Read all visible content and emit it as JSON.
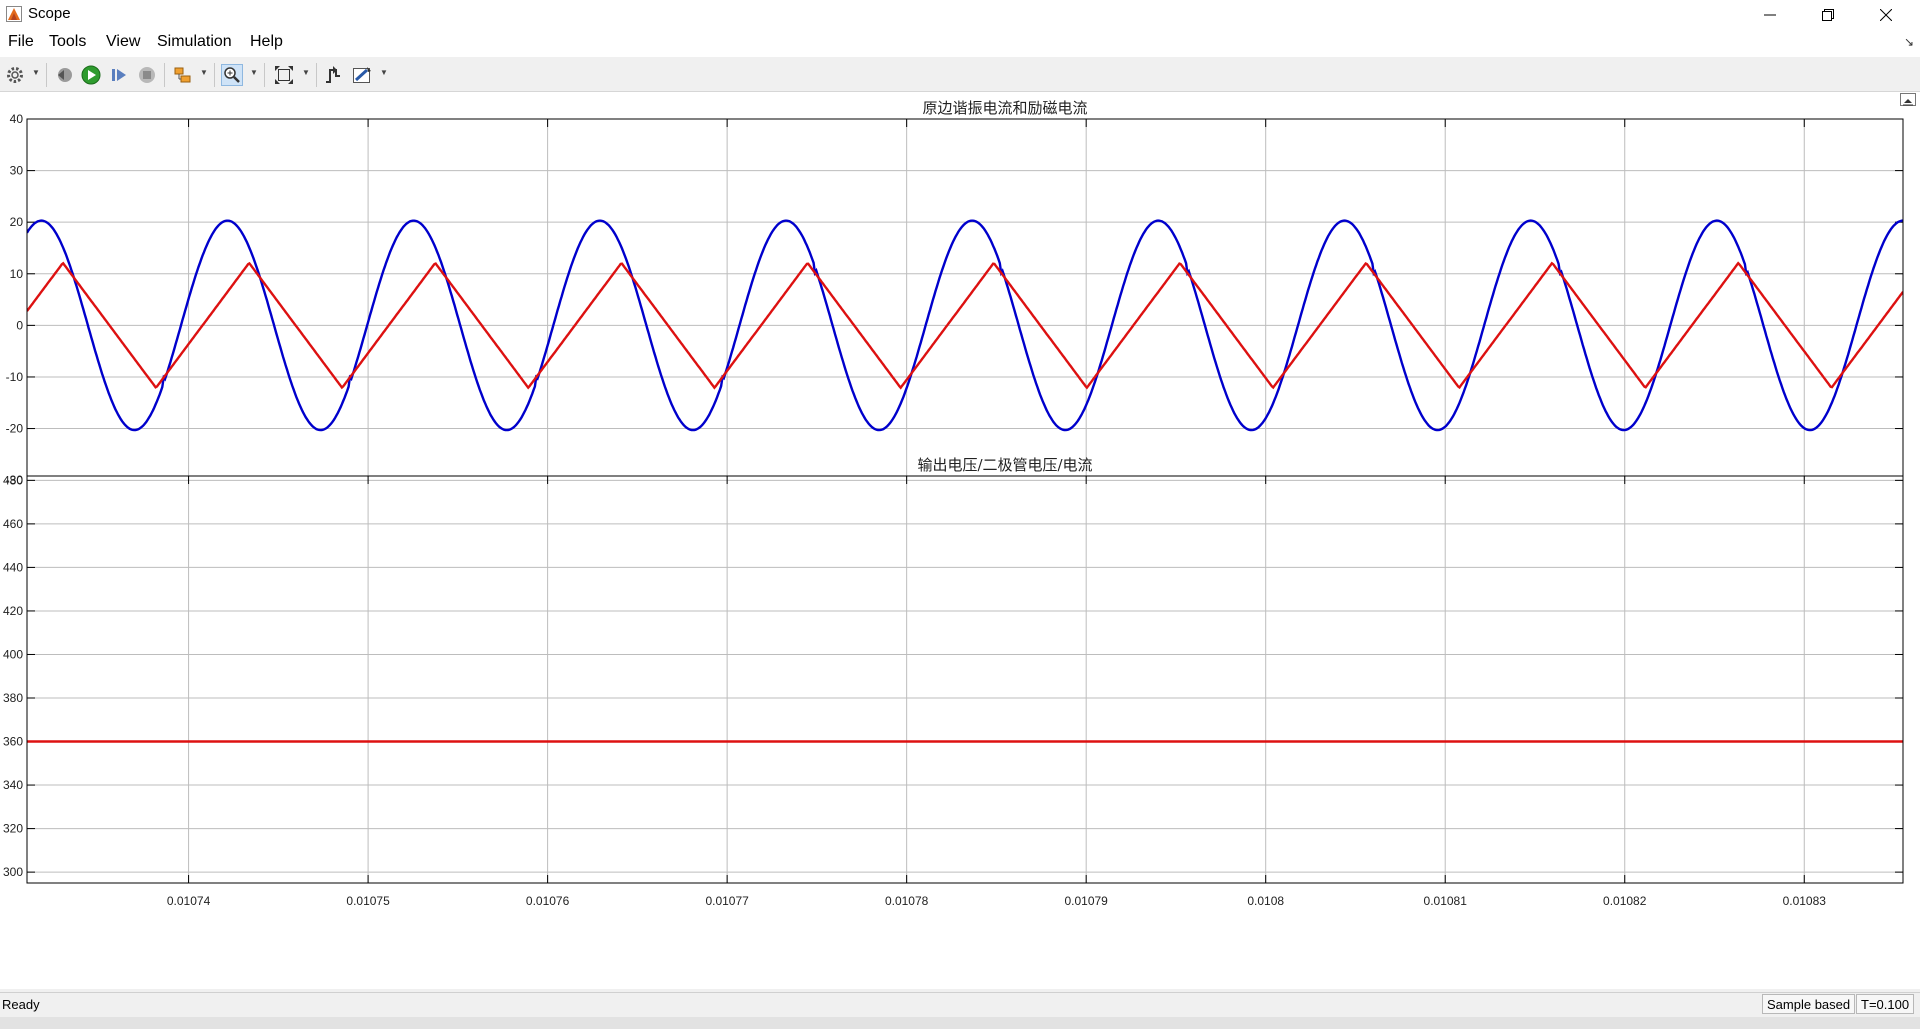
{
  "window": {
    "title": "Scope",
    "icon": "matlab-scope-icon",
    "controls": [
      "minimize-icon",
      "restore-icon",
      "close-icon"
    ]
  },
  "menu": [
    "File",
    "Tools",
    "View",
    "Simulation",
    "Help"
  ],
  "toolbar": [
    "settings-icon",
    "step-back-icon",
    "run-icon",
    "step-forward-icon",
    "stop-icon",
    "highlight-icon",
    "zoom-in-icon",
    "fit-to-view-icon",
    "triggers-icon",
    "cursor-measurements-icon"
  ],
  "colors": {
    "series_blue": "#0000cc",
    "series_red": "#dd1111",
    "grid": "#bdbdbd",
    "axes": "#000000"
  },
  "status": {
    "left": "Ready",
    "mode": "Sample based",
    "time": "T=0.100"
  },
  "chart_data": [
    {
      "type": "line",
      "title": "原边谐振电流和励磁电流",
      "xlim": [
        0.010731,
        0.0108355
      ],
      "ylim": [
        -38.5,
        40
      ],
      "yticks": [
        -30,
        -20,
        -10,
        0,
        10,
        20,
        30,
        40
      ],
      "xticks": [
        0.01074,
        0.01075,
        0.01076,
        0.01077,
        0.01078,
        0.01079,
        0.0108,
        0.01081,
        0.01082,
        0.01083
      ],
      "grid": true,
      "series": [
        {
          "color": "#0000cc",
          "shape": "resonant-sine",
          "period": 1.037e-05,
          "amplitude": 20.3,
          "peak_x": 0.0107318,
          "trough_x": 0.0107362,
          "flat_min": 11,
          "points": []
        },
        {
          "color": "#dd1111",
          "shape": "triangle",
          "period": 1.037e-05,
          "peak": 12.1,
          "peak_x": 0.010733,
          "trough_x": 0.0107382,
          "points": []
        }
      ]
    },
    {
      "type": "line",
      "title": "输出电压/二极管电压/电流",
      "xlim": [
        0.010731,
        0.0108355
      ],
      "ylim": [
        295,
        482
      ],
      "yticks": [
        300,
        320,
        340,
        360,
        380,
        400,
        420,
        440,
        460,
        480
      ],
      "xticks": [
        0.01074,
        0.01075,
        0.01076,
        0.01077,
        0.01078,
        0.01079,
        0.0108,
        0.01081,
        0.01082,
        0.01083
      ],
      "xtick_labels": [
        "0.01074",
        "0.01075",
        "0.01076",
        "0.01077",
        "0.01078",
        "0.01079",
        "0.0108",
        "0.01081",
        "0.01082",
        "0.01083"
      ],
      "grid": true,
      "series": [
        {
          "color": "#dd1111",
          "constant": 360,
          "x": [
            0.010731,
            0.0108355
          ],
          "y": [
            360,
            360
          ]
        }
      ]
    }
  ]
}
